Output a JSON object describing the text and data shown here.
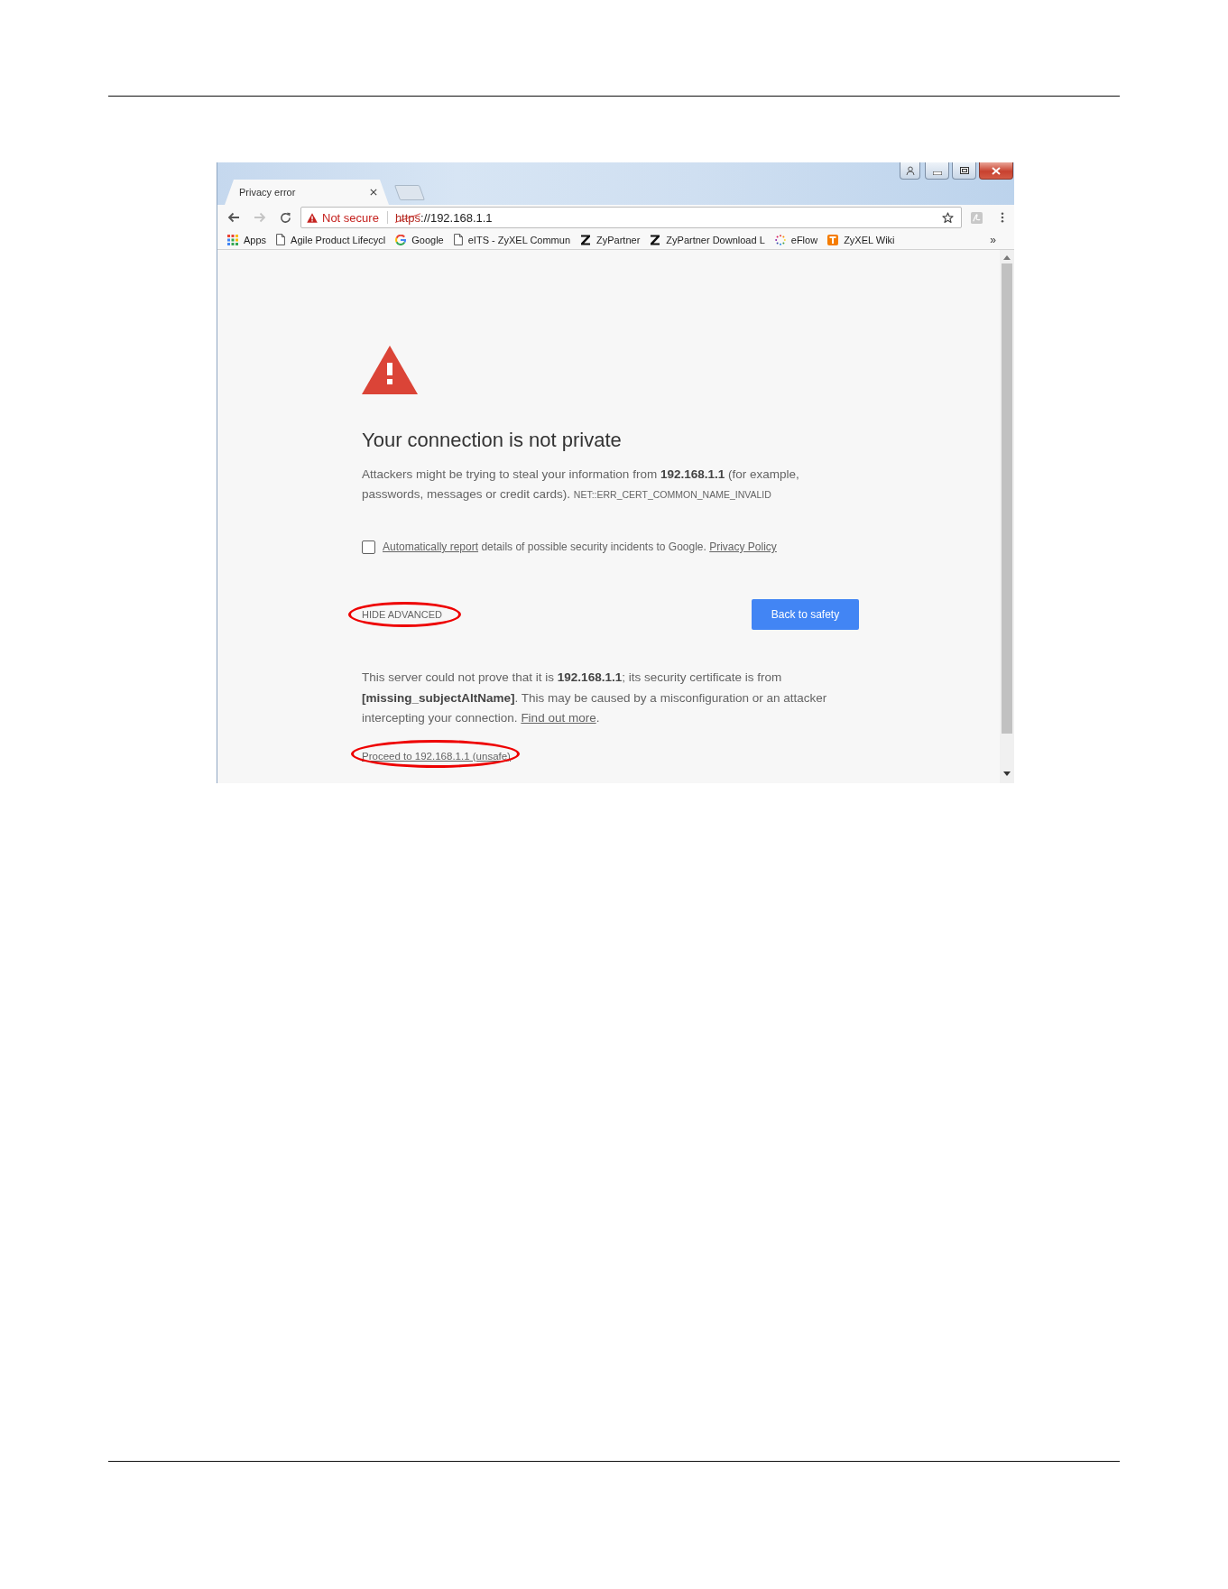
{
  "browser": {
    "tab": {
      "title": "Privacy error",
      "selected": true
    },
    "navigation": {
      "back_disabled": false,
      "forward_disabled": true
    },
    "address_bar": {
      "security_label": "Not secure",
      "url_scheme": "https",
      "scheme_struck": true,
      "url_rest": "://192.168.1.1"
    },
    "bookmarks": [
      {
        "kind": "apps",
        "label": "Apps"
      },
      {
        "kind": "page",
        "label": "Agile Product Lifecycl"
      },
      {
        "kind": "google",
        "label": "Google"
      },
      {
        "kind": "page",
        "label": "eITS - ZyXEL Commun"
      },
      {
        "kind": "z",
        "label": "ZyPartner"
      },
      {
        "kind": "z",
        "label": "ZyPartner Download L"
      },
      {
        "kind": "eflow",
        "label": "eFlow"
      },
      {
        "kind": "wiki",
        "label": "ZyXEL Wiki"
      }
    ],
    "bookmarks_overflow": "»"
  },
  "page": {
    "heading": "Your connection is not private",
    "intro": "Attackers might be trying to steal your information from **192.168.1.1** (for example, passwords, messages or credit cards).",
    "error_code": "NET::ERR_CERT_COMMON_NAME_INVALID",
    "report": {
      "checked": false,
      "link": "Automatically report",
      "text": "details of possible security incidents to Google.",
      "policy_link": "Privacy Policy"
    },
    "advanced_toggle": {
      "label": "HIDE ADVANCED",
      "circled": true
    },
    "safety_button": "Back to safety",
    "details": {
      "text": "This server could not prove that it is **192.168.1.1**; its security certificate is from **[missing_subjectAltName]**. This may be caused by a misconfiguration or an attacker intercepting your connection.",
      "link": "Find out more",
      "tail": "."
    },
    "proceed": {
      "label": "Proceed to 192.168.1.1 (unsafe)",
      "circled": true
    }
  }
}
